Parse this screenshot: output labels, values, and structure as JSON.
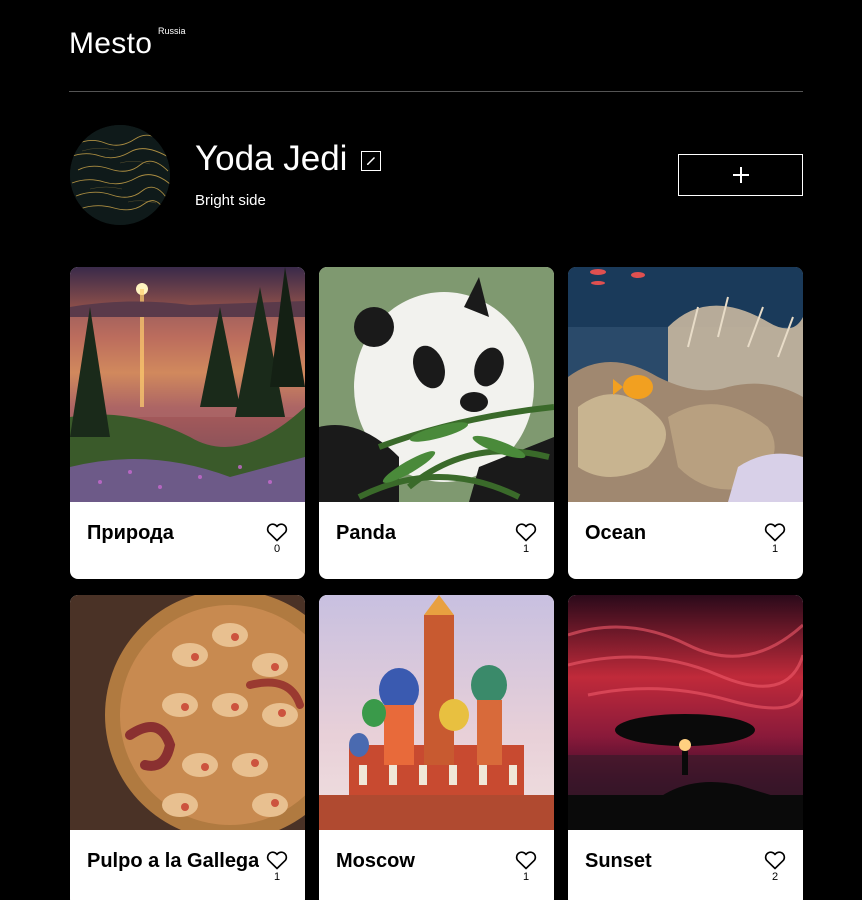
{
  "header": {
    "logo": "Mesto",
    "logo_sup": "Russia"
  },
  "profile": {
    "name": "Yoda Jedi",
    "about": "Bright side",
    "avatar_icon": "avatar-image",
    "edit_icon": "pencil-icon",
    "add_icon": "plus-icon"
  },
  "cards": [
    {
      "title": "Природа",
      "likes": "0",
      "image": "sunset-lake-forest"
    },
    {
      "title": "Panda",
      "likes": "1",
      "image": "panda-eating-bamboo"
    },
    {
      "title": "Ocean",
      "likes": "1",
      "image": "coral-reef-fish"
    },
    {
      "title": "Pulpo a la Gallega",
      "likes": "1",
      "image": "octopus-dish"
    },
    {
      "title": "Moscow",
      "likes": "1",
      "image": "st-basils-cathedral"
    },
    {
      "title": "Sunset",
      "likes": "2",
      "image": "tree-red-sky"
    }
  ],
  "colors": {
    "background": "#000000",
    "card": "#ffffff",
    "divider": "#545454"
  }
}
